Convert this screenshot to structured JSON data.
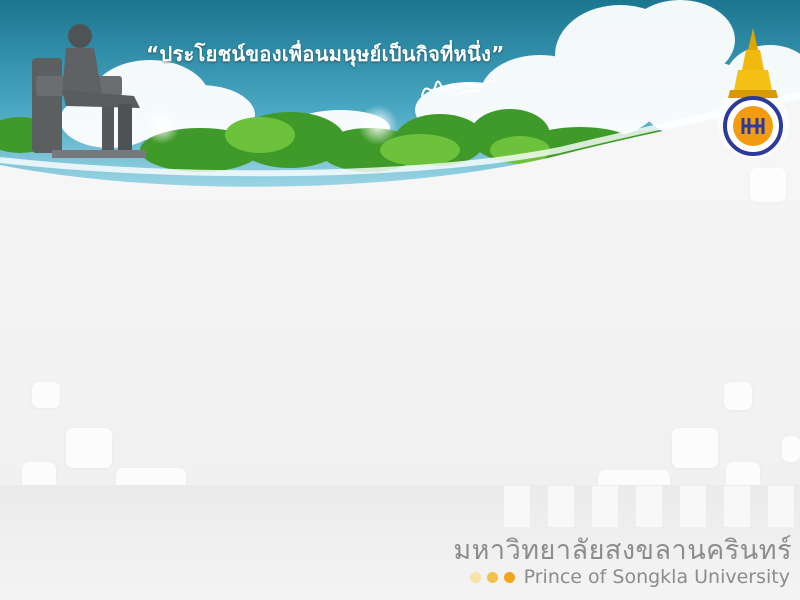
{
  "banner": {
    "motto": "“ประโยชน์ของเพื่อนมนุษย์เป็นกิจที่หนึ่ง”"
  },
  "icons": {
    "statue": "royal-statue-image",
    "signature": "royal-signature-image",
    "seal": "university-emblem-image"
  },
  "footer": {
    "university_name_thai": "มหาวิทยาลัยสงขลานครินทร์",
    "university_name_english": "Prince of Songkla University",
    "dot_colors": [
      "#f7e2a8",
      "#f3c04e",
      "#f2a51c"
    ]
  },
  "colors": {
    "sky_top": "#1d7d93",
    "sky_bottom": "#8fd0e3",
    "canvas": "#f4f4f4",
    "text_gray": "#8c8c8c"
  }
}
